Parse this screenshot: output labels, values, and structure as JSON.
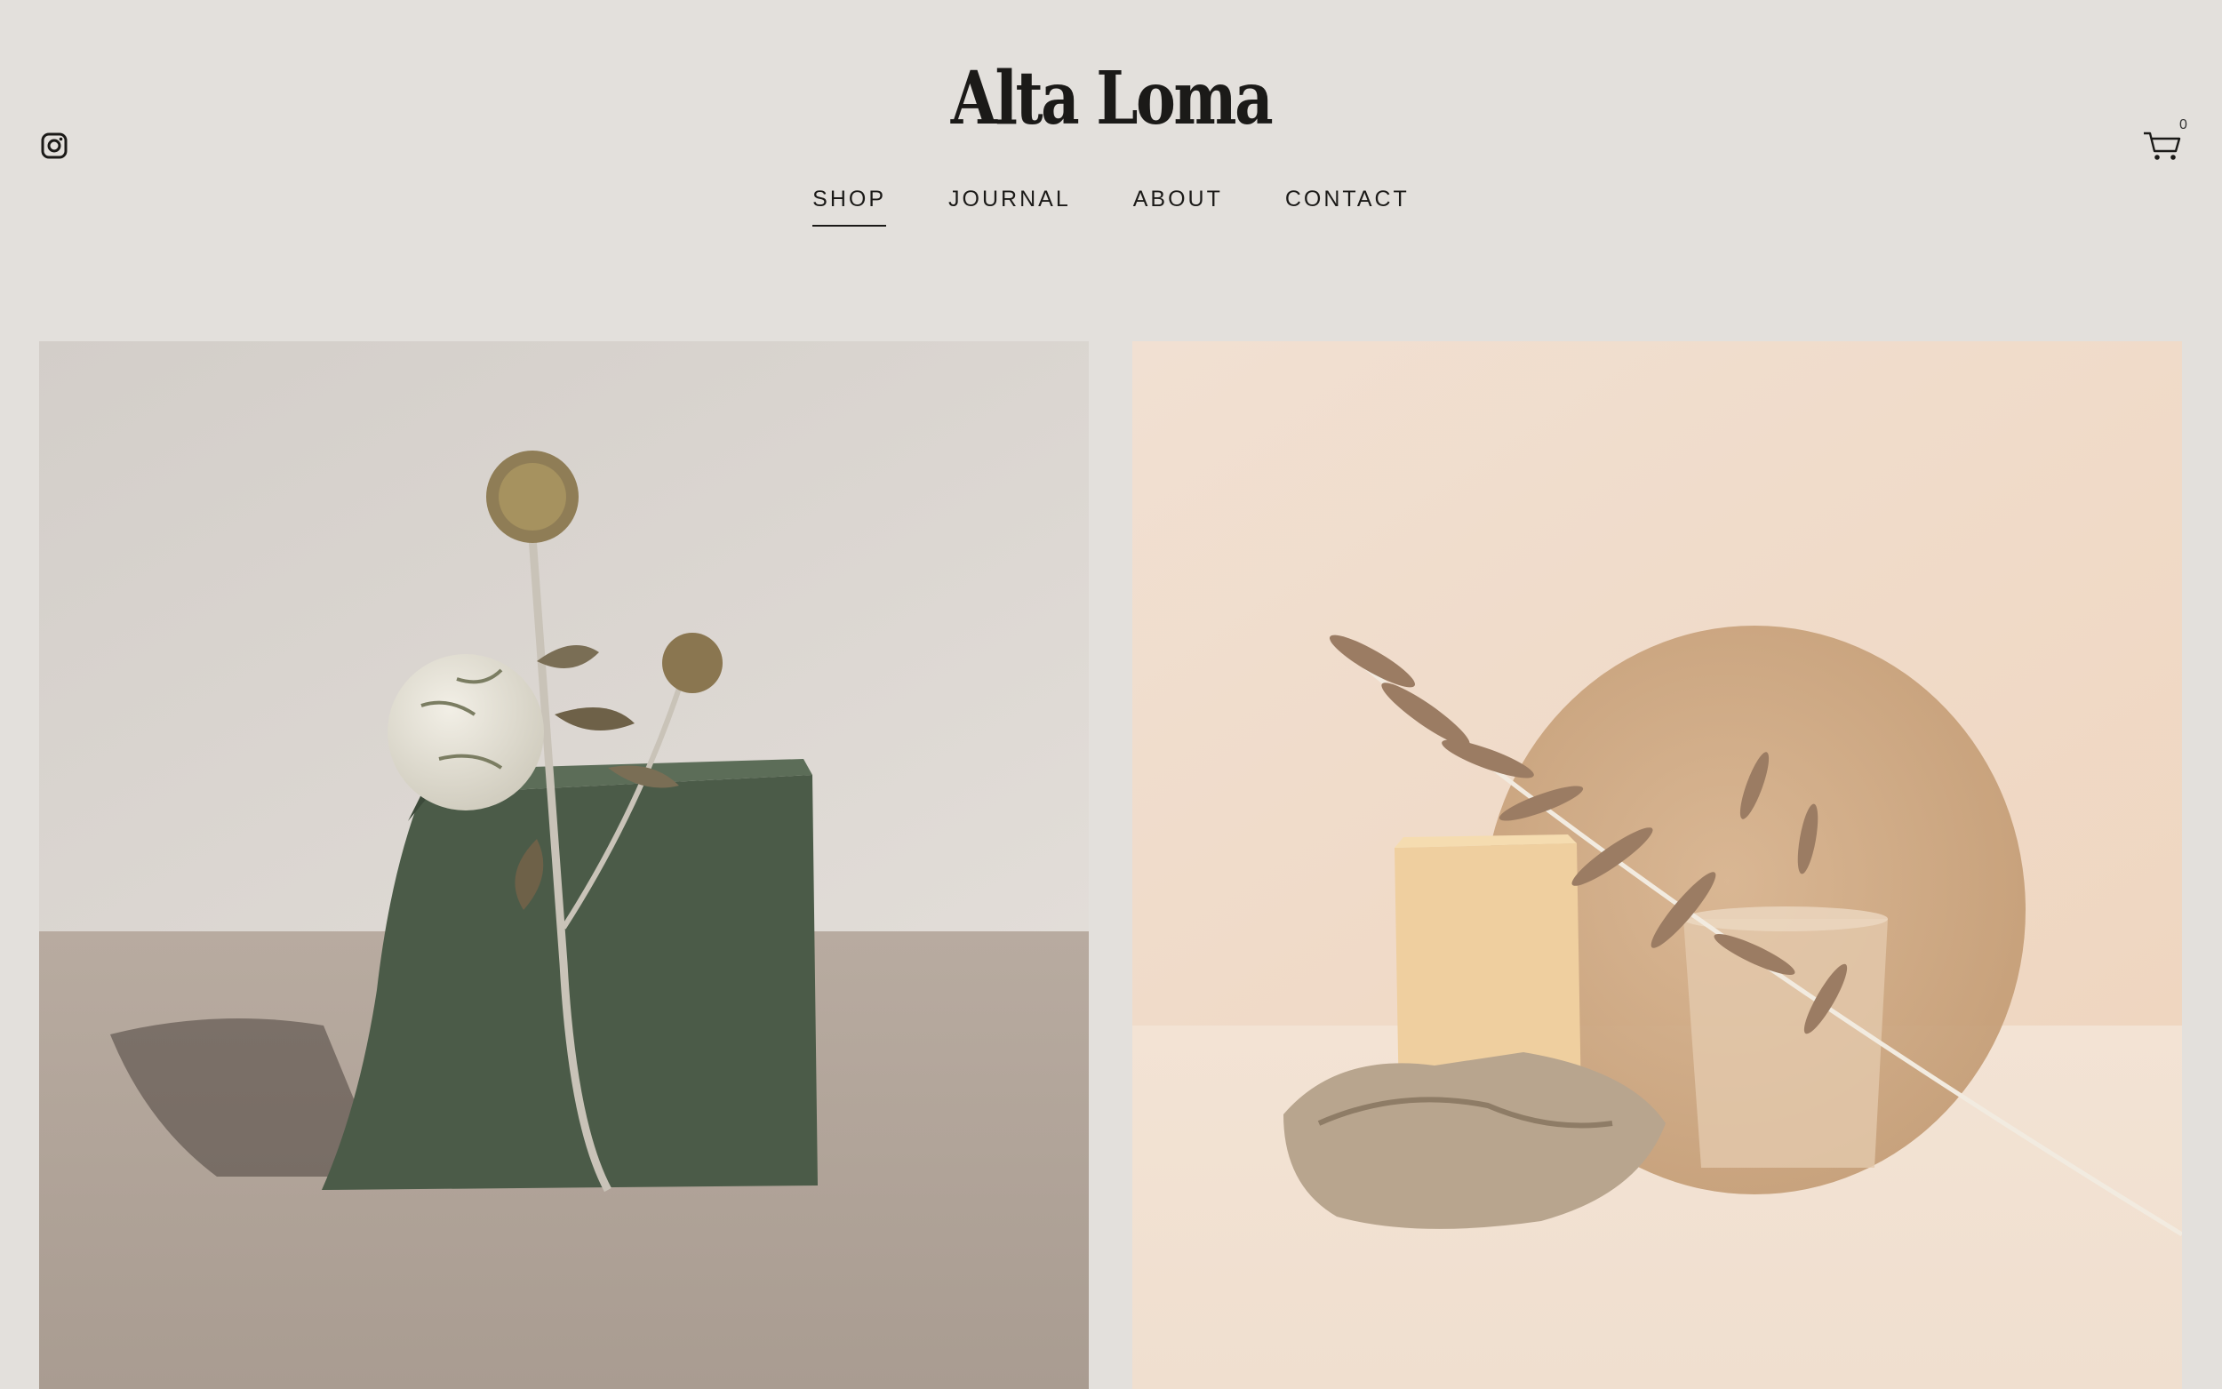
{
  "brand": {
    "name": "Alta Loma"
  },
  "header": {
    "instagram_icon": "instagram-icon",
    "cart_icon": "cart-icon",
    "cart_count": "0"
  },
  "nav": {
    "items": [
      {
        "label": "SHOP",
        "active": true
      },
      {
        "label": "JOURNAL",
        "active": false
      },
      {
        "label": "ABOUT",
        "active": false
      },
      {
        "label": "CONTACT",
        "active": false
      }
    ]
  },
  "products": [
    {
      "image": "green-block-thistle-photo"
    },
    {
      "image": "soap-mirror-grass-photo"
    }
  ],
  "colors": {
    "background": "#e3e0dc",
    "text": "#1b1a18"
  }
}
